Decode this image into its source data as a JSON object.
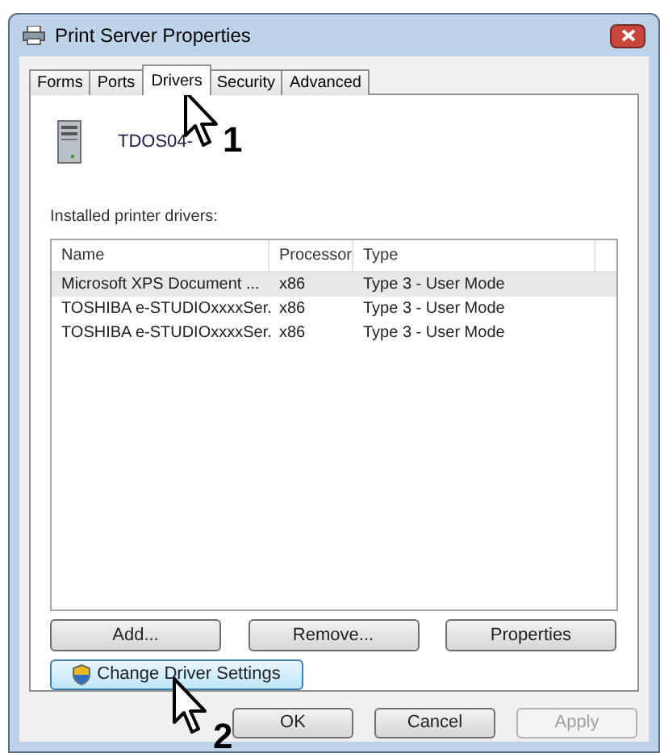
{
  "window": {
    "title": "Print Server Properties"
  },
  "tabs": [
    {
      "label": "Forms",
      "selected": false
    },
    {
      "label": "Ports",
      "selected": false
    },
    {
      "label": "Drivers",
      "selected": true
    },
    {
      "label": "Security",
      "selected": false
    },
    {
      "label": "Advanced",
      "selected": false
    }
  ],
  "server_name": "TDOS04-",
  "list_label": "Installed printer drivers:",
  "table": {
    "columns": [
      "Name",
      "Processor",
      "Type"
    ],
    "rows": [
      {
        "cells": [
          "Microsoft XPS Document ...",
          "x86",
          "Type 3 - User Mode"
        ],
        "selected": true
      },
      {
        "cells": [
          "TOSHIBA e-STUDIOxxxxSer.",
          "x86",
          "Type 3 - User Mode"
        ],
        "selected": false
      },
      {
        "cells": [
          "TOSHIBA e-STUDIOxxxxSer.",
          "x86",
          "Type 3 - User Mode"
        ],
        "selected": false
      }
    ]
  },
  "list_buttons": [
    "Add...",
    "Remove...",
    "Properties"
  ],
  "change_button": "Change Driver Settings",
  "dialog_buttons": [
    {
      "label": "OK",
      "disabled": false
    },
    {
      "label": "Cancel",
      "disabled": false
    },
    {
      "label": "Apply",
      "disabled": true
    }
  ],
  "callouts": [
    "1",
    "2"
  ]
}
